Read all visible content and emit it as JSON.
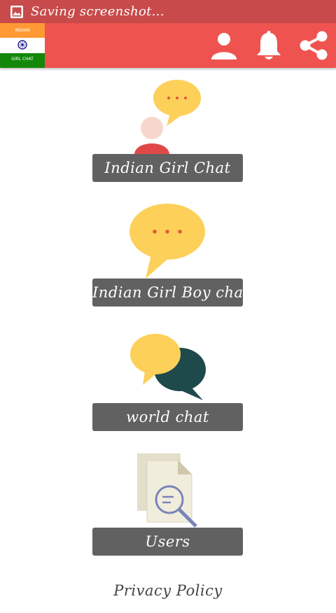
{
  "status_bar": {
    "text": "Saving screenshot..."
  },
  "app_bar": {
    "logo": {
      "top_text": "INDIAN",
      "bottom_text": "GIRL CHAT"
    },
    "actions": [
      {
        "icon": "user-icon"
      },
      {
        "icon": "bell-icon"
      },
      {
        "icon": "share-icon"
      }
    ]
  },
  "menu": [
    {
      "label": "Indian Girl Chat",
      "icon": "girl-chat-icon"
    },
    {
      "label": "Indian Girl Boy chat",
      "icon": "chat-bubble-icon"
    },
    {
      "label": "world chat",
      "icon": "double-chat-bubble-icon"
    },
    {
      "label": "Users",
      "icon": "document-search-icon"
    }
  ],
  "footer": {
    "privacy_label": "Privacy Policy"
  },
  "colors": {
    "status_bar": "#c84a4a",
    "app_bar": "#ef5350",
    "button": "#616161",
    "bubble_yellow": "#fdd05a",
    "bubble_dark": "#1f4a4c"
  }
}
